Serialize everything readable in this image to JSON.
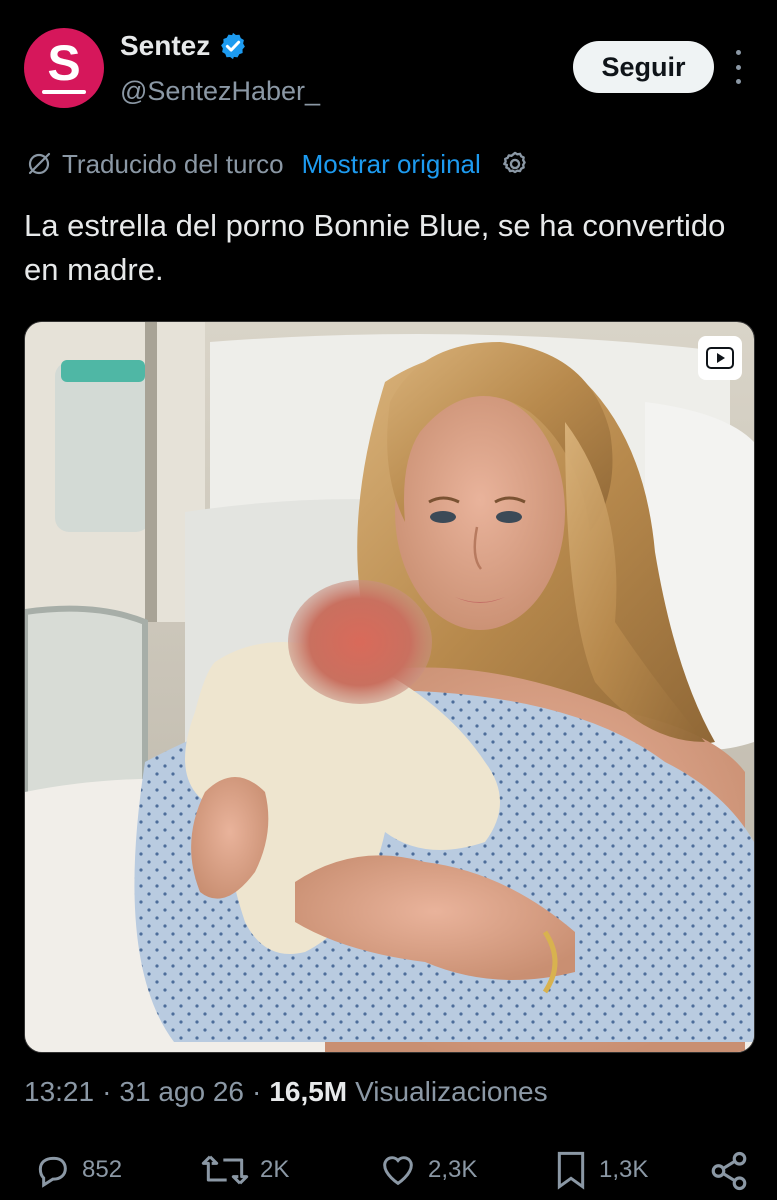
{
  "tweet": {
    "display_name": "Sentez",
    "handle": "@SentezHaber_",
    "avatar_letter": "S",
    "follow_label": "Seguir",
    "translated_label": "Traducido del turco",
    "show_original_label": "Mostrar original",
    "text": "La estrella del porno Bonnie Blue, se ha convertido en madre.",
    "time": "13:21",
    "date": "31 ago 26",
    "views_count": "16,5M",
    "views_label": "Visualizaciones",
    "replies": "852",
    "reposts": "2K",
    "likes": "2,3K",
    "bookmarks": "1,3K",
    "separator": "·"
  },
  "icons": {
    "verified": "verified-badge-icon",
    "translate": "translate-slash-icon",
    "settings": "gear-icon",
    "video": "video-play-icon",
    "reply": "reply-icon",
    "repost": "repost-icon",
    "like": "heart-icon",
    "bookmark": "bookmark-icon",
    "share": "share-icon",
    "more": "more-vertical-icon"
  },
  "colors": {
    "background": "#000000",
    "text": "#e7e9ea",
    "muted": "#8b98a5",
    "link": "#1d9bf0",
    "avatar": "#d6175b",
    "verified": "#1d9bf0"
  }
}
